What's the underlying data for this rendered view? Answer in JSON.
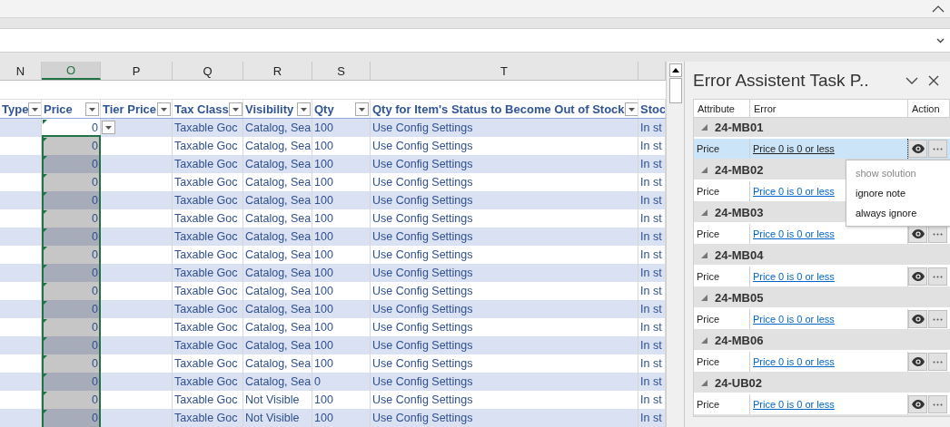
{
  "column_letters": [
    {
      "label": "N",
      "selected": false
    },
    {
      "label": "O",
      "selected": true
    },
    {
      "label": "P",
      "selected": false
    },
    {
      "label": "Q",
      "selected": false
    },
    {
      "label": "R",
      "selected": false
    },
    {
      "label": "S",
      "selected": false
    },
    {
      "label": "T",
      "selected": false
    }
  ],
  "table": {
    "columns": [
      "Type",
      "Price",
      "Tier Price",
      "Tax Class",
      "Visibility",
      "Qty",
      "Qty for Item's Status to Become Out of Stock",
      "Stoc"
    ],
    "rows": [
      {
        "active": true,
        "price": "0",
        "tax_class": "Taxable Goc",
        "visibility": "Catalog, Sea",
        "qty": "100",
        "status_qty": "Use Config Settings",
        "stock": "In st"
      },
      {
        "active": false,
        "price": "0",
        "tax_class": "Taxable Goc",
        "visibility": "Catalog, Sea",
        "qty": "100",
        "status_qty": "Use Config Settings",
        "stock": "In st"
      },
      {
        "active": false,
        "price": "0",
        "tax_class": "Taxable Goc",
        "visibility": "Catalog, Sea",
        "qty": "100",
        "status_qty": "Use Config Settings",
        "stock": "In st"
      },
      {
        "active": false,
        "price": "0",
        "tax_class": "Taxable Goc",
        "visibility": "Catalog, Sea",
        "qty": "100",
        "status_qty": "Use Config Settings",
        "stock": "In st"
      },
      {
        "active": false,
        "price": "0",
        "tax_class": "Taxable Goc",
        "visibility": "Catalog, Sea",
        "qty": "100",
        "status_qty": "Use Config Settings",
        "stock": "In st"
      },
      {
        "active": false,
        "price": "0",
        "tax_class": "Taxable Goc",
        "visibility": "Catalog, Sea",
        "qty": "100",
        "status_qty": "Use Config Settings",
        "stock": "In st"
      },
      {
        "active": false,
        "price": "0",
        "tax_class": "Taxable Goc",
        "visibility": "Catalog, Sea",
        "qty": "100",
        "status_qty": "Use Config Settings",
        "stock": "In st"
      },
      {
        "active": false,
        "price": "0",
        "tax_class": "Taxable Goc",
        "visibility": "Catalog, Sea",
        "qty": "100",
        "status_qty": "Use Config Settings",
        "stock": "In st"
      },
      {
        "active": false,
        "price": "0",
        "tax_class": "Taxable Goc",
        "visibility": "Catalog, Sea",
        "qty": "100",
        "status_qty": "Use Config Settings",
        "stock": "In st"
      },
      {
        "active": false,
        "price": "0",
        "tax_class": "Taxable Goc",
        "visibility": "Catalog, Sea",
        "qty": "100",
        "status_qty": "Use Config Settings",
        "stock": "In st"
      },
      {
        "active": false,
        "price": "0",
        "tax_class": "Taxable Goc",
        "visibility": "Catalog, Sea",
        "qty": "100",
        "status_qty": "Use Config Settings",
        "stock": "In st"
      },
      {
        "active": false,
        "price": "0",
        "tax_class": "Taxable Goc",
        "visibility": "Catalog, Sea",
        "qty": "100",
        "status_qty": "Use Config Settings",
        "stock": "In st"
      },
      {
        "active": false,
        "price": "0",
        "tax_class": "Taxable Goc",
        "visibility": "Catalog, Sea",
        "qty": "100",
        "status_qty": "Use Config Settings",
        "stock": "In st"
      },
      {
        "active": false,
        "price": "0",
        "tax_class": "Taxable Goc",
        "visibility": "Catalog, Sea",
        "qty": "100",
        "status_qty": "Use Config Settings",
        "stock": "In st"
      },
      {
        "active": false,
        "price": "0",
        "tax_class": "Taxable Goc",
        "visibility": "Catalog, Sea",
        "qty": "0",
        "status_qty": "Use Config Settings",
        "stock": "In st"
      },
      {
        "active": false,
        "price": "0",
        "tax_class": "Taxable Goc",
        "visibility": "Not Visible",
        "qty": "100",
        "status_qty": "Use Config Settings",
        "stock": "In st"
      },
      {
        "active": false,
        "price": "0",
        "tax_class": "Taxable Goc",
        "visibility": "Not Visible",
        "qty": "100",
        "status_qty": "Use Config Settings",
        "stock": "In st"
      }
    ]
  },
  "task_pane": {
    "title": "Error Assistent Task P..",
    "columns": [
      "Attribute",
      "Error",
      "Action"
    ],
    "groups": [
      {
        "sku": "24-MB01",
        "expanded": true,
        "items": [
          {
            "attribute": "Price",
            "error": "Price 0 is 0 or less",
            "selected": true
          }
        ]
      },
      {
        "sku": "24-MB02",
        "expanded": true,
        "items": [
          {
            "attribute": "Price",
            "error": "Price 0 is 0 or less",
            "selected": false
          }
        ]
      },
      {
        "sku": "24-MB03",
        "expanded": true,
        "items": [
          {
            "attribute": "Price",
            "error": "Price 0 is 0 or less",
            "selected": false
          }
        ]
      },
      {
        "sku": "24-MB04",
        "expanded": true,
        "items": [
          {
            "attribute": "Price",
            "error": "Price 0 is 0 or less",
            "selected": false
          }
        ]
      },
      {
        "sku": "24-MB05",
        "expanded": true,
        "items": [
          {
            "attribute": "Price",
            "error": "Price 0 is 0 or less",
            "selected": false
          }
        ]
      },
      {
        "sku": "24-MB06",
        "expanded": true,
        "items": [
          {
            "attribute": "Price",
            "error": "Price 0 is 0 or less",
            "selected": false
          }
        ]
      },
      {
        "sku": "24-UB02",
        "expanded": true,
        "items": [
          {
            "attribute": "Price",
            "error": "Price 0 is 0 or less",
            "selected": false
          }
        ]
      }
    ],
    "menu": {
      "items": [
        {
          "label": "show solution",
          "disabled": true
        },
        {
          "label": "ignore note",
          "disabled": false
        },
        {
          "label": "always ignore",
          "disabled": false
        }
      ]
    }
  }
}
